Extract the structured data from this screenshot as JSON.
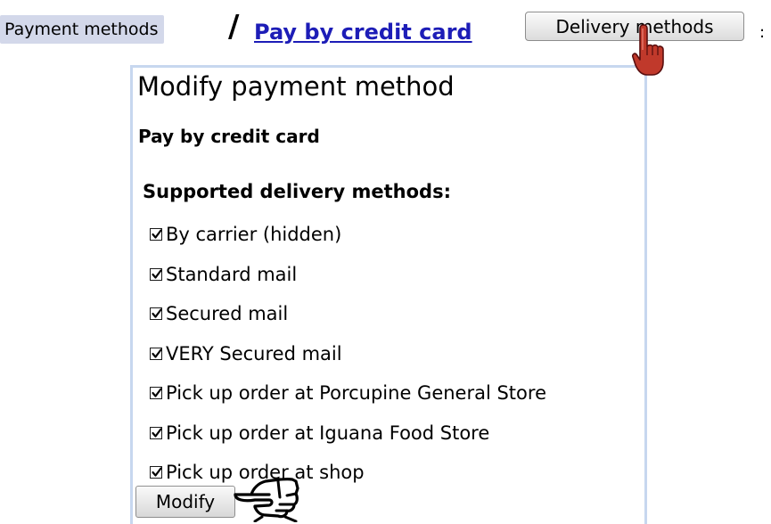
{
  "breadcrumb": {
    "parent": "Payment methods",
    "separator": "/",
    "current": "Pay by credit card",
    "action_button": "Delivery methods",
    "trailing": ":"
  },
  "form": {
    "title": "Modify payment method",
    "method_name": "Pay by credit card",
    "section_label": "Supported delivery methods:",
    "delivery_methods": [
      {
        "label": "By carrier (hidden)",
        "checked": true
      },
      {
        "label": "Standard mail",
        "checked": true
      },
      {
        "label": "Secured mail",
        "checked": true
      },
      {
        "label": "VERY Secured mail",
        "checked": true
      },
      {
        "label": "Pick up order at Porcupine General Store",
        "checked": true
      },
      {
        "label": "Pick up order at Iguana Food Store",
        "checked": true
      },
      {
        "label": "Pick up order at shop",
        "checked": true
      }
    ],
    "submit_label": "Modify"
  },
  "colors": {
    "breadcrumb_bg": "#d3d8ea",
    "link": "#1d1db7",
    "form_border": "#c7d7ef",
    "cursor_red": "#c0392b"
  },
  "icons": {
    "pointer_cursor": "pointing-hand-cursor-icon",
    "hand_cursor": "outlined-pointing-hand-icon",
    "checkbox": "checkmark-icon"
  }
}
